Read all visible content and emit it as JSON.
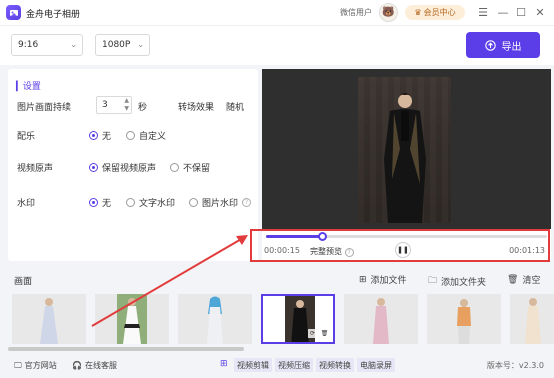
{
  "titlebar": {
    "app_title": "金舟电子相册",
    "user_name": "微信用户",
    "vip_label": "会员中心"
  },
  "toolbar": {
    "ratio_value": "9:16",
    "resolution_value": "1080P",
    "export_label": "导出"
  },
  "settings": {
    "title": "设置",
    "duration_label": "图片画面持续",
    "duration_value": "3",
    "duration_unit": "秒",
    "transition_label": "转场效果",
    "transition_value": "随机",
    "music_label": "配乐",
    "music_options": [
      "无",
      "自定义"
    ],
    "audio_label": "视频原声",
    "audio_options": [
      "保留视频原声",
      "不保留"
    ],
    "watermark_label": "水印",
    "watermark_options": [
      "无",
      "文字水印",
      "图片水印"
    ]
  },
  "preview": {
    "current_time": "00:00:15",
    "total_time": "00:01:13",
    "full_preview_label": "完整预览",
    "progress_fraction": 0.2
  },
  "frames": {
    "title": "画面",
    "add_file": "添加文件",
    "add_folder": "添加文件夹",
    "clear": "清空",
    "selected_index": 3
  },
  "footer": {
    "website": "官方网站",
    "support": "在线客服",
    "tools": [
      "视频剪辑",
      "视频压缩",
      "视频转换",
      "电脑录屏"
    ],
    "version": "版本号：v2.3.0"
  },
  "colors": {
    "accent": "#5b3ee8",
    "highlight": "#e23b3b"
  }
}
